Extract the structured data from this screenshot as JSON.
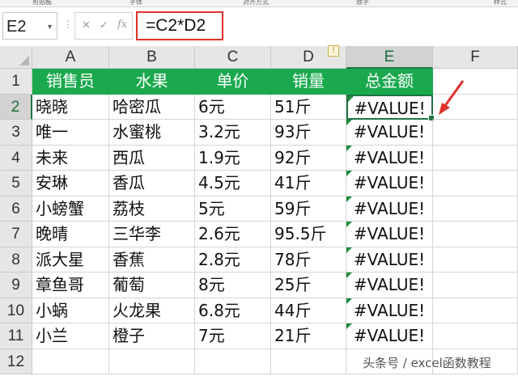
{
  "name_box": "E2",
  "formula": "=C2*D2",
  "columns": [
    "A",
    "B",
    "C",
    "D",
    "E",
    "F"
  ],
  "rows": [
    "1",
    "2",
    "3",
    "4",
    "5",
    "6",
    "7",
    "8",
    "9",
    "10",
    "11",
    "12"
  ],
  "header": [
    "销售员",
    "水果",
    "单价",
    "销量",
    "总金额"
  ],
  "data": [
    [
      "晓晓",
      "哈密瓜",
      "6元",
      "51斤",
      "#VALUE!"
    ],
    [
      "唯一",
      "水蜜桃",
      "3.2元",
      "93斤",
      "#VALUE!"
    ],
    [
      "未来",
      "西瓜",
      "1.9元",
      "92斤",
      "#VALUE!"
    ],
    [
      "安琳",
      "香瓜",
      "4.5元",
      "41斤",
      "#VALUE!"
    ],
    [
      "小螃蟹",
      "荔枝",
      "5元",
      "59斤",
      "#VALUE!"
    ],
    [
      "晚晴",
      "三华李",
      "2.6元",
      "95.5斤",
      "#VALUE!"
    ],
    [
      "派大星",
      "香蕉",
      "2.8元",
      "78斤",
      "#VALUE!"
    ],
    [
      "章鱼哥",
      "葡萄",
      "8元",
      "25斤",
      "#VALUE!"
    ],
    [
      "小蜗",
      "火龙果",
      "6.8元",
      "44斤",
      "#VALUE!"
    ],
    [
      "小兰",
      "橙子",
      "7元",
      "21斤",
      "#VALUE!"
    ]
  ],
  "watermark": "头条号 / excel函数教程",
  "colors": {
    "header_bg": "#1aa94d",
    "header_text": "#ffffff",
    "accent": "#217346",
    "annotation": "#e0312b"
  }
}
